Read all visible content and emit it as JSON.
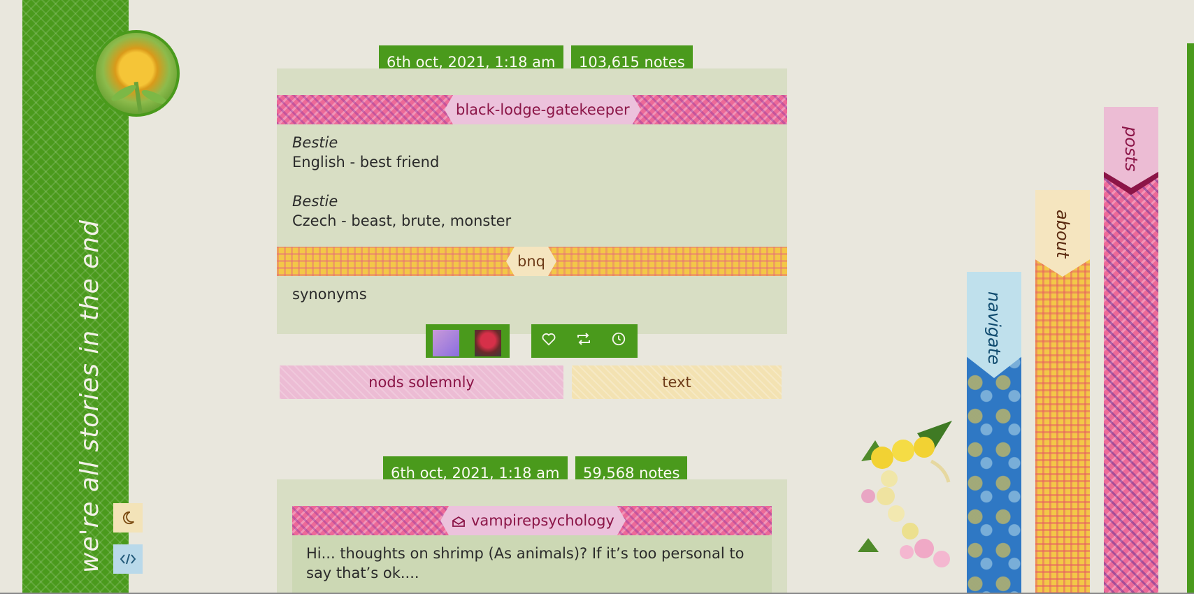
{
  "sidebar": {
    "tagline": "we're all stories in the end",
    "moon_icon": "moon-icon",
    "code_icon": "code-icon"
  },
  "colors": {
    "green": "#4a9a1c",
    "background": "#e9e7dd",
    "post_bg": "#d8dec4",
    "pink": "#ec6a98",
    "yellow": "#f3c748",
    "blue": "#2f78c4"
  },
  "posts": [
    {
      "date": "6th oct, 2021, 1:18 am",
      "notes": "103,615 notes",
      "author": "black-lodge-gatekeeper",
      "body": [
        {
          "term": "Bestie",
          "def": "English - best friend"
        },
        {
          "term": "Bestie",
          "def": "Czech - beast, brute, monster"
        }
      ],
      "reblog_author": "bnq",
      "reblog_text": "synonyms",
      "actions": {
        "like": "heart-icon",
        "reblog": "reblog-icon",
        "later": "clock-icon"
      },
      "tags": [
        "nods solemnly",
        "text"
      ]
    },
    {
      "date": "6th oct, 2021, 1:18 am",
      "notes": "59,568 notes",
      "author": "vampirepsychology",
      "author_icon": "envelope-icon",
      "body_text": "Hi... thoughts on shrimp (As animals)? If it’s too personal to say that’s ok...."
    }
  ],
  "nav": {
    "navigate": "navigate",
    "about": "about",
    "posts": "posts"
  }
}
